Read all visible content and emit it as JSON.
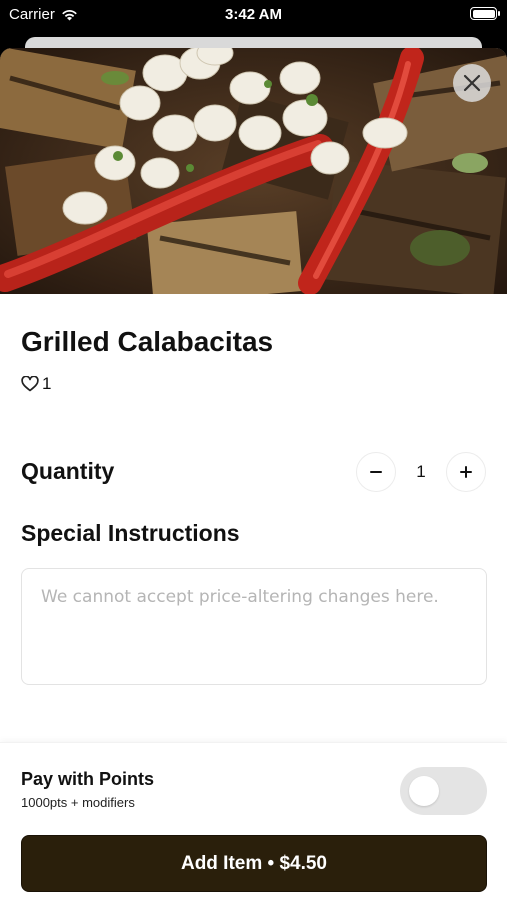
{
  "status_bar": {
    "carrier": "Carrier",
    "time": "3:42 AM"
  },
  "item": {
    "name": "Grilled Calabacitas",
    "likes": "1",
    "image_description_icon": "food-photo"
  },
  "quantity": {
    "label": "Quantity",
    "value": "1",
    "decrement": "−",
    "increment": "+"
  },
  "special_instructions": {
    "label": "Special Instructions",
    "placeholder": "We cannot accept price-altering changes here.",
    "value": ""
  },
  "points": {
    "title": "Pay with Points",
    "subtitle": "1000pts + modifiers",
    "enabled": false
  },
  "add_button": {
    "label": "Add Item • $4.50"
  },
  "colors": {
    "primary_button": "#2a1f0b",
    "toggle_off": "#e4e4e4"
  },
  "icons": {
    "close": "close-icon",
    "heart": "heart-icon",
    "wifi": "wifi-icon",
    "battery": "battery-icon"
  }
}
